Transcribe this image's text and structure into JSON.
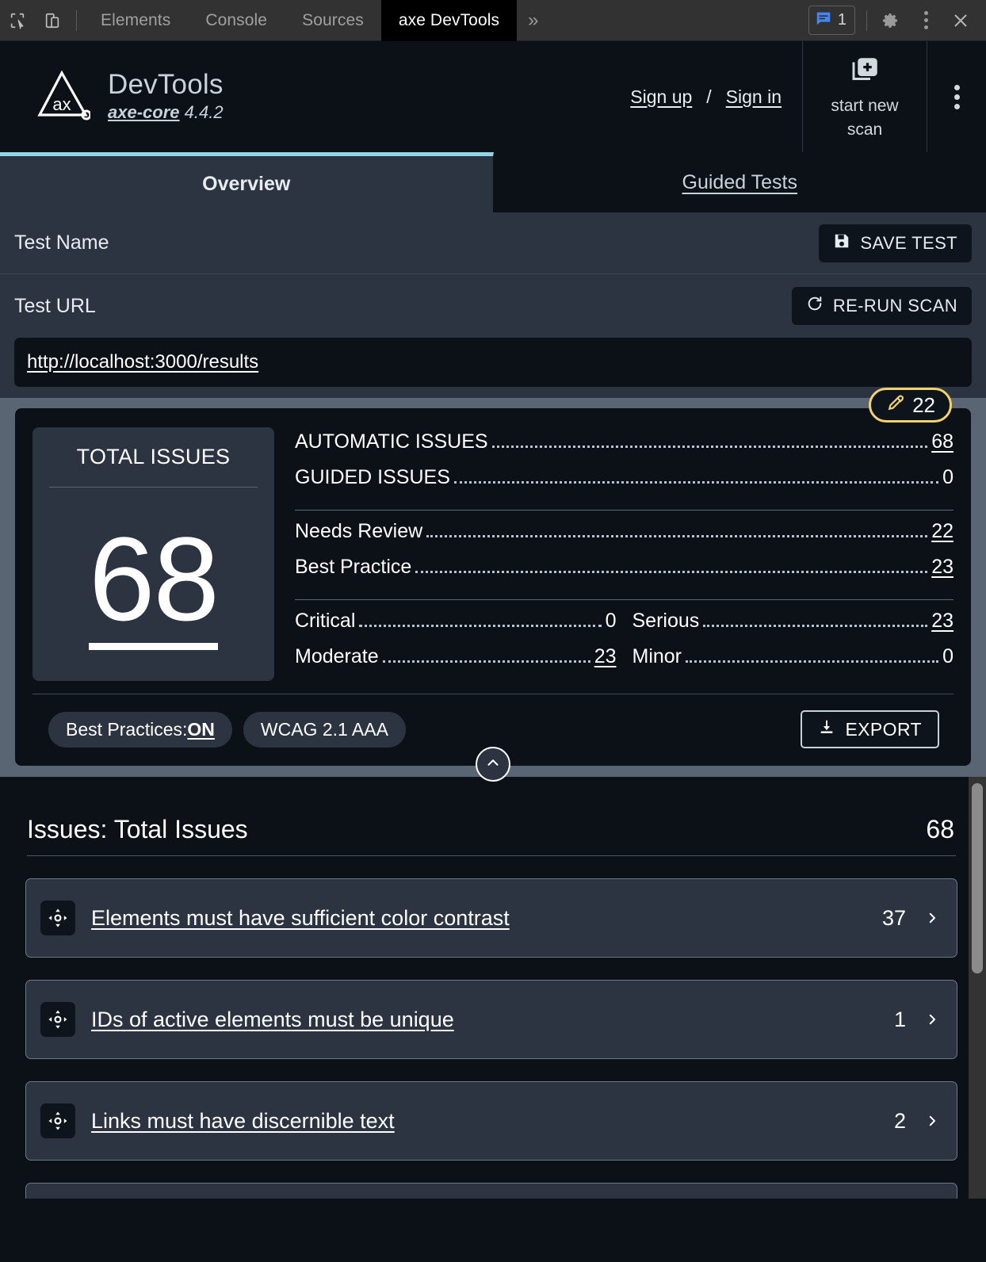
{
  "devtools_bar": {
    "left_icons": [
      {
        "name": "inspect-element-icon"
      },
      {
        "name": "device-toolbar-icon"
      }
    ],
    "tabs": [
      {
        "label": "Elements",
        "active": false
      },
      {
        "label": "Console",
        "active": false
      },
      {
        "label": "Sources",
        "active": false
      },
      {
        "label": "axe DevTools",
        "active": true
      }
    ],
    "overflow_label": "»",
    "message_count": "1",
    "right_icons": [
      "messages-icon",
      "gear-icon",
      "kebab-menu-icon",
      "close-icon"
    ]
  },
  "header": {
    "logo_name": "axe-logo",
    "title": "DevTools",
    "core_name": "axe-core",
    "core_version": "4.4.2",
    "sign_up": "Sign up",
    "separator": "/",
    "sign_in": "Sign in",
    "start_scan_line1": "start new",
    "start_scan_line2": "scan",
    "kebab_name": "header-kebab-menu"
  },
  "tabs": [
    {
      "label": "Overview",
      "active": true
    },
    {
      "label": "Guided Tests",
      "active": false
    }
  ],
  "test_name": {
    "label": "Test Name",
    "save_label": "SAVE TEST"
  },
  "test_url": {
    "label": "Test URL",
    "rerun_label": "RE-RUN SCAN",
    "url": "http://localhost:3000/results"
  },
  "summary": {
    "eyedropper_badge": {
      "icon": "eyedropper-icon",
      "count": "22",
      "border_color": "#f2d26b"
    },
    "total": {
      "title": "TOTAL ISSUES",
      "value": "68"
    },
    "stats_primary": [
      {
        "label": "AUTOMATIC ISSUES",
        "value": "68",
        "is_link": true
      },
      {
        "label": "GUIDED ISSUES",
        "value": "0",
        "is_link": false
      }
    ],
    "stats_secondary": [
      {
        "label": "Needs Review",
        "value": "22",
        "is_link": true
      },
      {
        "label": "Best Practice",
        "value": "23",
        "is_link": true
      }
    ],
    "severity_left": [
      {
        "label": "Critical",
        "value": "0",
        "is_link": false
      },
      {
        "label": "Moderate",
        "value": "23",
        "is_link": true
      }
    ],
    "severity_right": [
      {
        "label": "Serious",
        "value": "23",
        "is_link": true
      },
      {
        "label": "Minor",
        "value": "0",
        "is_link": false
      }
    ],
    "footer": {
      "best_practices_prefix": "Best Practices: ",
      "best_practices_state": "ON",
      "standard_chip": "WCAG 2.1 AAA",
      "export_label": "EXPORT",
      "collapse_icon": "chevron-up-icon"
    }
  },
  "issues": {
    "heading": "Issues: Total Issues",
    "total": "68",
    "rows": [
      {
        "icon": "target-crosshair-icon",
        "label": "Elements must have sufficient color contrast",
        "count": "37"
      },
      {
        "icon": "target-crosshair-icon",
        "label": "IDs of active elements must be unique",
        "count": "1"
      },
      {
        "icon": "target-crosshair-icon",
        "label": "Links must have discernible text",
        "count": "2"
      }
    ]
  },
  "colors": {
    "accent_tab": "#92d6e8",
    "badge_yellow": "#f2d26b",
    "panel_frame": "#5a6573",
    "card_bg": "#2b3440",
    "deep_bg": "#0b1117",
    "devtools_chrome": "#323232",
    "message_blue": "#4285f4"
  }
}
